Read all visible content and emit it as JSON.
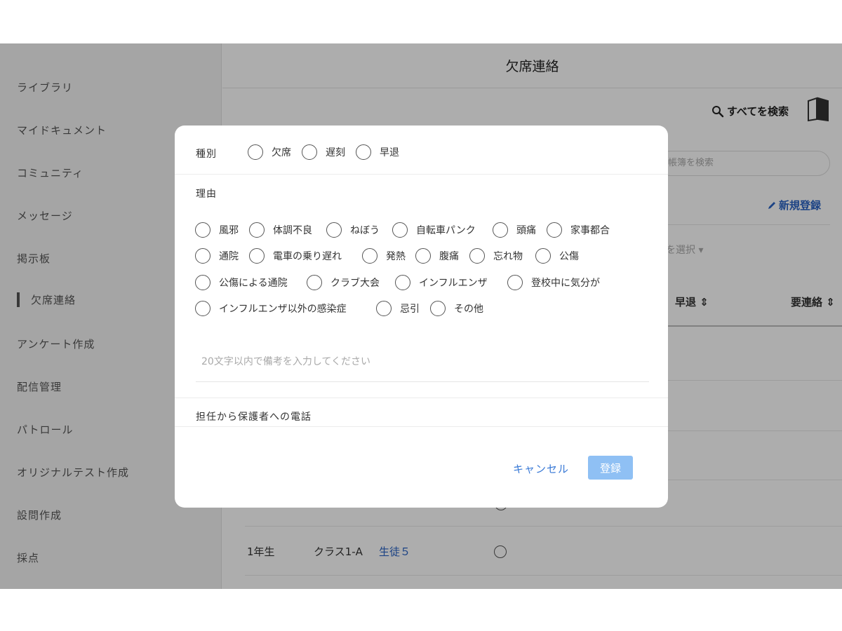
{
  "sidebar": {
    "items": [
      {
        "label": "ライブラリ"
      },
      {
        "label": "マイドキュメント"
      },
      {
        "label": "コミュニティ"
      },
      {
        "label": "メッセージ"
      },
      {
        "label": "掲示板"
      },
      {
        "label": "欠席連絡",
        "active": true
      },
      {
        "label": "アンケート作成"
      },
      {
        "label": "配信管理"
      },
      {
        "label": "パトロール"
      },
      {
        "label": "オリジナルテスト作成"
      },
      {
        "label": "設問作成"
      },
      {
        "label": "採点"
      }
    ]
  },
  "header": {
    "title": "欠席連絡",
    "search_all_label": "すべてを検索",
    "search_icon": "search-icon",
    "book_icon": "book-icon"
  },
  "toolbar": {
    "ledger_search_placeholder": "帳簿を検索",
    "new_register_label": "新規登録",
    "select_label": "を選択"
  },
  "table": {
    "columns": [
      "早退",
      "要連絡"
    ],
    "rows": [
      {
        "grade": "1年生",
        "class": "クラス1-A",
        "student": "生徒５"
      }
    ]
  },
  "modal": {
    "type_label": "種別",
    "type_options": [
      "欠席",
      "遅刻",
      "早退"
    ],
    "reason_label": "理由",
    "reason_options": [
      [
        "風邪",
        "体調不良",
        "ねぼう",
        "自転車パンク",
        "頭痛",
        "家事都合"
      ],
      [
        "通院",
        "電車の乗り遅れ",
        "発熱",
        "腹痛",
        "忘れ物",
        "公傷"
      ],
      [
        "公傷による通院",
        "クラブ大会",
        "インフルエンザ",
        "登校中に気分が"
      ],
      [
        "インフルエンザ以外の感染症",
        "忌引",
        "その他"
      ]
    ],
    "memo_placeholder": "20文字以内で備考を入力してください",
    "phone_label": "担任から保護者への電話",
    "cancel_label": "キャンセル",
    "register_label": "登録"
  },
  "colors": {
    "link": "#2a63c4",
    "register_button": "#8fc0f4",
    "overlay": "rgba(0,0,0,0.32)"
  }
}
